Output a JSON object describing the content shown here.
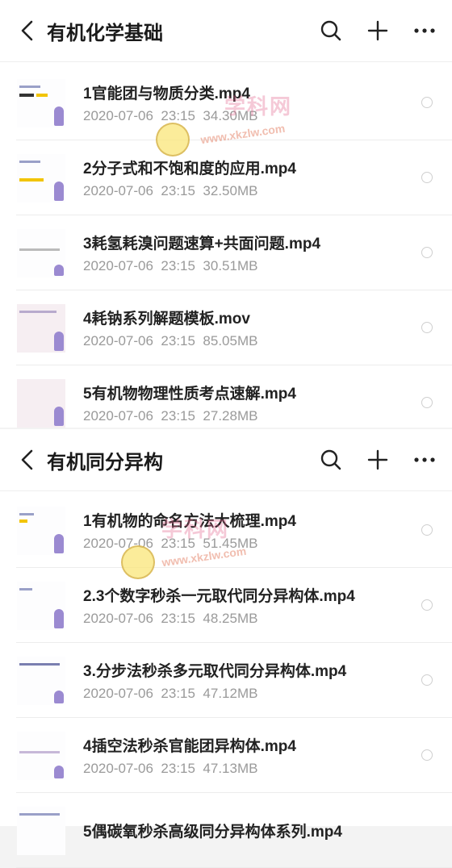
{
  "folders": [
    {
      "title": "有机化学基础",
      "files": [
        {
          "name": "1官能团与物质分类.mp4",
          "date": "2020-07-06",
          "time": "23:15",
          "size": "34.30MB"
        },
        {
          "name": "2分子式和不饱和度的应用.mp4",
          "date": "2020-07-06",
          "time": "23:15",
          "size": "32.50MB"
        },
        {
          "name": "3耗氢耗溴问题速算+共面问题.mp4",
          "date": "2020-07-06",
          "time": "23:15",
          "size": "30.51MB"
        },
        {
          "name": "4耗钠系列解题模板.mov",
          "date": "2020-07-06",
          "time": "23:15",
          "size": "85.05MB"
        },
        {
          "name": "5有机物物理性质考点速解.mp4",
          "date": "2020-07-06",
          "time": "23:15",
          "size": "27.28MB"
        }
      ]
    },
    {
      "title": "有机同分异构",
      "files": [
        {
          "name": "1有机物的命名方法大梳理.mp4",
          "date": "2020-07-06",
          "time": "23:15",
          "size": "51.45MB"
        },
        {
          "name": "2.3个数字秒杀一元取代同分异构体.mp4",
          "date": "2020-07-06",
          "time": "23:15",
          "size": "48.25MB"
        },
        {
          "name": "3.分步法秒杀多元取代同分异构体.mp4",
          "date": "2020-07-06",
          "time": "23:15",
          "size": "47.12MB"
        },
        {
          "name": "4插空法秒杀官能团异构体.mp4",
          "date": "2020-07-06",
          "time": "23:15",
          "size": "47.13MB"
        },
        {
          "name": "5偶碳氧秒杀高级同分异构体系列.mp4",
          "date": "",
          "time": "",
          "size": ""
        }
      ]
    }
  ],
  "icons": {
    "back": "chevron-left-icon",
    "search": "search-icon",
    "add": "plus-icon",
    "more": "more-icon"
  },
  "watermark": {
    "text_cn": "学科网",
    "text_url": "www.xkzlw.com"
  },
  "colors": {
    "title": "#1a1a1a",
    "meta": "#9a9a9a",
    "background": "#ffffff"
  }
}
